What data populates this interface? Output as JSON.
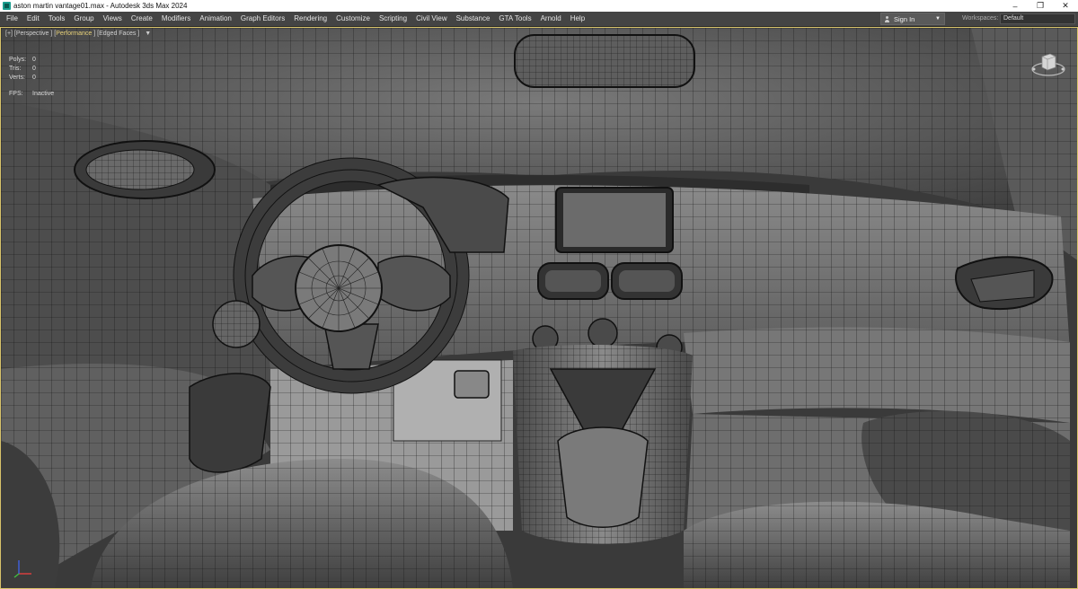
{
  "window": {
    "title": "aston martin vantage01.max - Autodesk 3ds Max 2024",
    "controls": [
      "–",
      "❐",
      "✕"
    ]
  },
  "menu": [
    "File",
    "Edit",
    "Tools",
    "Group",
    "Views",
    "Create",
    "Modifiers",
    "Animation",
    "Graph Editors",
    "Rendering",
    "Customize",
    "Scripting",
    "Civil View",
    "Substance",
    "GTA Tools",
    "Arnold",
    "Help"
  ],
  "account": {
    "signin_label": "Sign In"
  },
  "workspaces": {
    "label": "Workspaces:",
    "value": "Default"
  },
  "viewport": {
    "label_prefix": "[+] [",
    "view": "Perspective",
    "sep1": " ] [",
    "mode": "Performance",
    "sep2": " ] [",
    "shading": "Edged Faces",
    "suffix": " ]",
    "filter_icon": "funnel-icon",
    "stats": {
      "polys_label": "Polys:",
      "polys_value": "0",
      "tris_label": "Tris:",
      "tris_value": "0",
      "verts_label": "Verts:",
      "verts_value": "0",
      "fps_label": "FPS:",
      "fps_value": "Inactive"
    },
    "viewcube_face": "FRONT",
    "accent_border": "#d8c36a"
  }
}
